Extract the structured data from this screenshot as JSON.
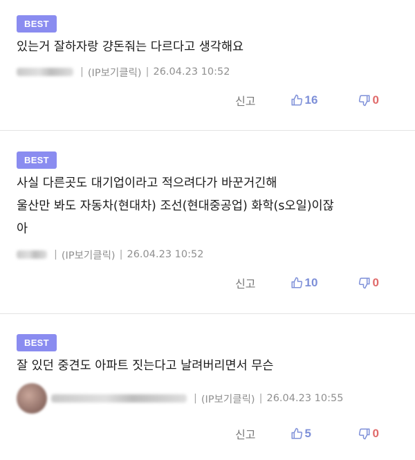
{
  "comments": [
    {
      "badge": "BEST",
      "lines": [
        "있는거 잘하자랑 걍돈줘는 다르다고 생각해요"
      ],
      "ip_label": "(IP보기클릭)",
      "timestamp": "26.04.23 10:52",
      "report_label": "신고",
      "likes": "16",
      "dislikes": "0"
    },
    {
      "badge": "BEST",
      "lines": [
        "사실 다른곳도 대기업이라고 적으려다가 바꾼거긴해",
        "울산만 봐도 자동차(현대차) 조선(현대중공업) 화학(s오일)이잖",
        "아"
      ],
      "ip_label": "(IP보기클릭)",
      "timestamp": "26.04.23 10:52",
      "report_label": "신고",
      "likes": "10",
      "dislikes": "0"
    },
    {
      "badge": "BEST",
      "lines": [
        "잘 있던 중견도 아파트 짓는다고 날려버리면서 무슨"
      ],
      "ip_label": "(IP보기클릭)",
      "timestamp": "26.04.23 10:55",
      "report_label": "신고",
      "likes": "5",
      "dislikes": "0"
    }
  ],
  "colors": {
    "badge": "#8a8cf0",
    "like": "#7d8fd8",
    "dislike": "#e06a6a",
    "meta": "#8f8f8f"
  },
  "icons": {
    "like": "thumbs-up-icon",
    "dislike": "thumbs-down-icon"
  }
}
